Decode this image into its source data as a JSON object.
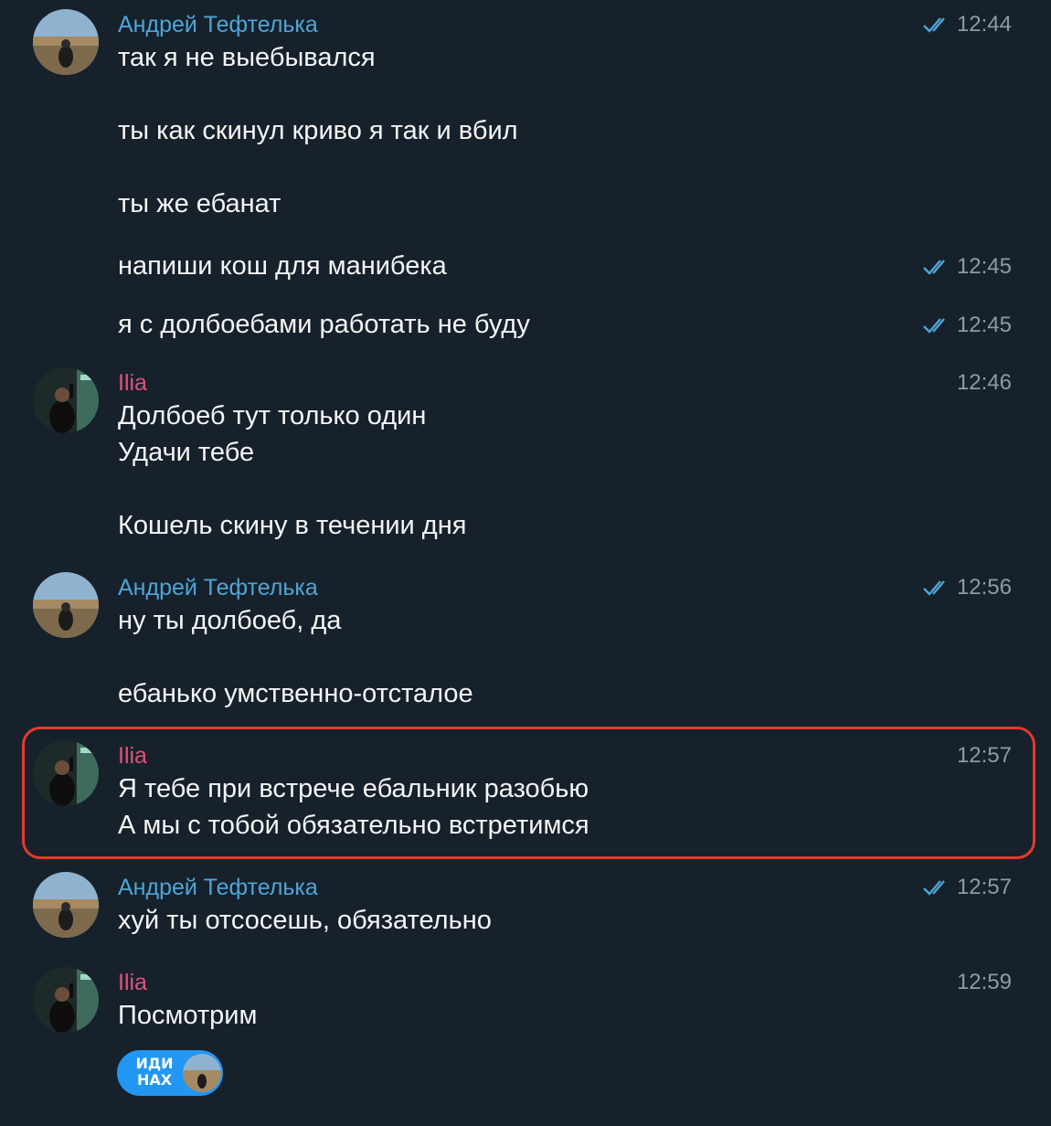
{
  "colors": {
    "background": "#17212b",
    "sender_andrey": "#4fa5d6",
    "sender_ilia": "#e0527a",
    "read_ticks": "#4fa5d6",
    "highlight_border": "#e33a2a",
    "sticker_bg": "#2196f3"
  },
  "groups": [
    {
      "sender": "Андрей Тефтелька",
      "time": "12:44",
      "lines": [
        "так я не выебывался",
        "ты как скинул криво я так и вбил",
        "ты же ебанат"
      ]
    },
    {
      "time": "12:45",
      "lines": [
        "напиши кош для манибека"
      ]
    },
    {
      "time": "12:45",
      "lines": [
        "я с долбоебами работать не буду"
      ]
    },
    {
      "sender": "Ilia",
      "time": "12:46",
      "lines": [
        "Долбоеб тут только один",
        "Удачи тебе",
        "Кошель скину в течении дня"
      ]
    },
    {
      "sender": "Андрей Тефтелька",
      "time": "12:56",
      "lines": [
        "ну ты долбоеб, да",
        "ебанько умственно-отсталое"
      ]
    },
    {
      "sender": "Ilia",
      "time": "12:57",
      "lines": [
        "Я тебе при встрече ебальник разобью",
        "А мы с тобой обязательно встретимся"
      ]
    },
    {
      "sender": "Андрей Тефтелька",
      "time": "12:57",
      "lines": [
        "хуй ты отсосешь, обязательно"
      ]
    },
    {
      "sender": "Ilia",
      "time": "12:59",
      "lines": [
        "Посмотрим"
      ]
    }
  ],
  "sticker": {
    "text_line1": "ИДИ",
    "text_line2": "НАХ"
  },
  "icons": {
    "read_status": "double-check-icon"
  }
}
